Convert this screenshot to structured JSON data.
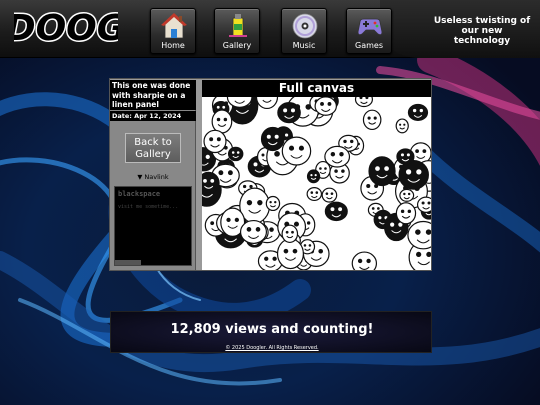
{
  "header": {
    "logo_text": "DOOG",
    "tagline": "Useless twisting of our new technology",
    "nav": [
      {
        "label": "Home",
        "icon": "house-icon"
      },
      {
        "label": "Gallery",
        "icon": "paint-tube-icon"
      },
      {
        "label": "Music",
        "icon": "cd-icon"
      },
      {
        "label": "Games",
        "icon": "gamepad-icon"
      }
    ]
  },
  "artwork": {
    "description": "This one was done with sharpie on a linen panel",
    "date": "Date: Apr 12, 2024",
    "back_button": "Back to Gallery",
    "navlink": "▼ Navlink",
    "canvas_title": "Full canvas"
  },
  "blackspace": {
    "title": "blackspace",
    "subtitle": "visit me sometime..."
  },
  "footer": {
    "views": "12,809 views and counting!",
    "copyright": "© 2025 Doogler. All Rights Reserved."
  },
  "colors": {
    "swirl_blue": "#1a6fd0",
    "swirl_magenta": "#c0307a",
    "panel_gray": "#8a8a8a"
  }
}
